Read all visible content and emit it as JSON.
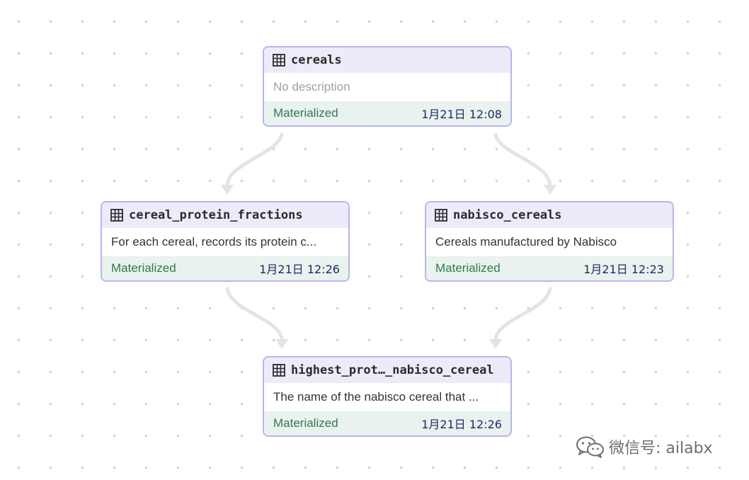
{
  "nodes": [
    {
      "id": "cereals",
      "title": "cereals",
      "description": "No description",
      "status": "Materialized",
      "timestamp": "1月21日 12:08"
    },
    {
      "id": "cereal_protein_fractions",
      "title": "cereal_protein_fractions",
      "description": "For each cereal, records its protein c...",
      "status": "Materialized",
      "timestamp": "1月21日 12:26"
    },
    {
      "id": "nabisco_cereals",
      "title": "nabisco_cereals",
      "description": "Cereals manufactured by Nabisco",
      "status": "Materialized",
      "timestamp": "1月21日 12:23"
    },
    {
      "id": "highest_protein_nabisco_cereal",
      "title": "highest_prot…_nabisco_cereal",
      "description": "The name of the nabisco cereal that ...",
      "status": "Materialized",
      "timestamp": "1月21日 12:26"
    }
  ],
  "edges": [
    {
      "from": "cereals",
      "to": "cereal_protein_fractions"
    },
    {
      "from": "cereals",
      "to": "nabisco_cereals"
    },
    {
      "from": "cereal_protein_fractions",
      "to": "highest_protein_nabisco_cereal"
    },
    {
      "from": "nabisco_cereals",
      "to": "highest_protein_nabisco_cereal"
    }
  ],
  "watermark": {
    "text": "微信号: ailabx",
    "icon": "wechat-icon"
  },
  "colors": {
    "node_border": "#b9b4ec",
    "node_header": "#ecebf9",
    "node_footer": "#e9f2ee",
    "status_text": "#2f7a4f",
    "timestamp_text": "#1e2a66",
    "edge": "#e4e4e4"
  }
}
